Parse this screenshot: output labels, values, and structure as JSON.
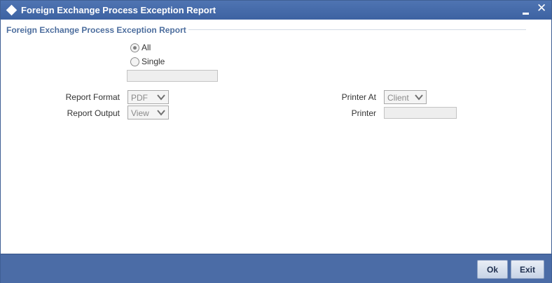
{
  "window": {
    "title": "Foreign Exchange Process Exception Report"
  },
  "section": {
    "heading": "Foreign Exchange Process Exception Report"
  },
  "selection": {
    "options": [
      {
        "label": "All",
        "checked": true
      },
      {
        "label": "Single",
        "checked": false
      }
    ],
    "single_value": ""
  },
  "fields": {
    "report_format_label": "Report Format",
    "report_format_value": "PDF",
    "report_output_label": "Report Output",
    "report_output_value": "View",
    "printer_at_label": "Printer At",
    "printer_at_value": "Client",
    "printer_label": "Printer",
    "printer_value": ""
  },
  "footer": {
    "ok_label": "Ok",
    "exit_label": "Exit"
  },
  "colors": {
    "titlebar": "#3d62a2",
    "footer": "#4b6ca6",
    "section_heading": "#4d6e9e"
  }
}
